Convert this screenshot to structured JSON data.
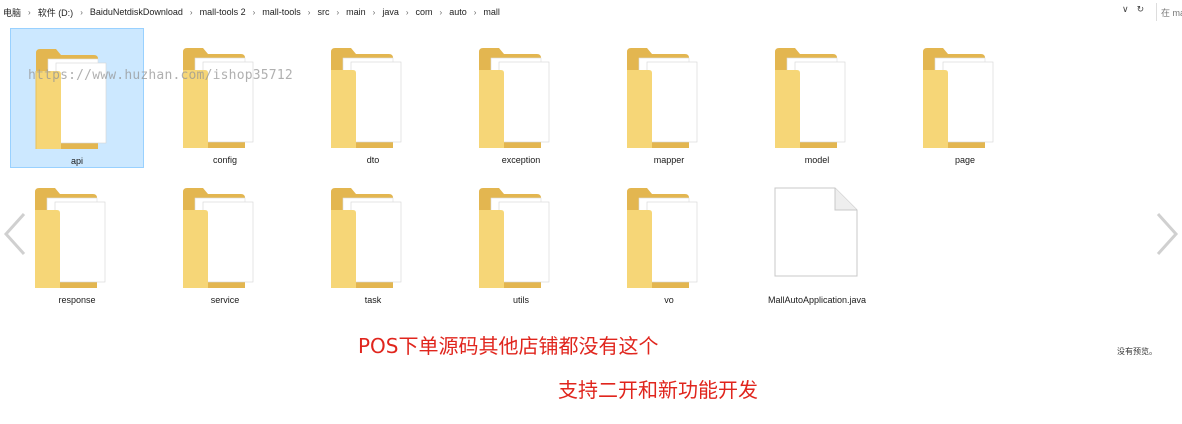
{
  "address_bar": {
    "crumbs": [
      "电脑",
      "软件 (D:)",
      "BaiduNetdiskDownload",
      "mall-tools 2",
      "mall-tools",
      "src",
      "main",
      "java",
      "com",
      "auto",
      "mall"
    ],
    "dropdown_glyph": "∨",
    "refresh_glyph": "↻",
    "search_placeholder": "在 ma"
  },
  "items": [
    {
      "name": "api",
      "type": "folder",
      "selected": true
    },
    {
      "name": "config",
      "type": "folder"
    },
    {
      "name": "dto",
      "type": "folder"
    },
    {
      "name": "exception",
      "type": "folder"
    },
    {
      "name": "mapper",
      "type": "folder"
    },
    {
      "name": "model",
      "type": "folder"
    },
    {
      "name": "page",
      "type": "folder"
    },
    {
      "name": "response",
      "type": "folder"
    },
    {
      "name": "service",
      "type": "folder"
    },
    {
      "name": "task",
      "type": "folder"
    },
    {
      "name": "utils",
      "type": "folder"
    },
    {
      "name": "vo",
      "type": "folder"
    },
    {
      "name": "MallAutoApplication.java",
      "type": "file"
    }
  ],
  "watermark": "https://www.huzhan.com/ishop35712",
  "preview_note": "没有预览。",
  "promo": {
    "line1": "POS下单源码其他店铺都没有这个",
    "line2": "支持二开和新功能开发"
  },
  "colors": {
    "folder_back": "#e9c15c",
    "folder_front": "#f7d679",
    "selection": "#cce8ff",
    "promo_text": "#e0251d"
  }
}
